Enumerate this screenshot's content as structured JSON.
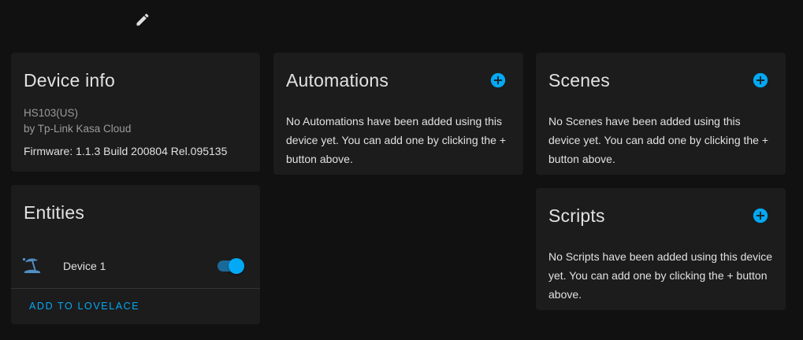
{
  "colors": {
    "background": "#111111",
    "card": "#1c1c1c",
    "accent": "#03a9f4",
    "text": "#e1e1e1",
    "muted": "#9b9b9b"
  },
  "header": {
    "edit_icon": "pencil-icon"
  },
  "device_info": {
    "title": "Device info",
    "model": "HS103(US)",
    "manufacturer": "by Tp-Link Kasa Cloud",
    "firmware": "Firmware: 1.1.3 Build 200804 Rel.095135"
  },
  "entities": {
    "title": "Entities",
    "items": [
      {
        "name": "Device 1",
        "icon": "beach-umbrella-icon",
        "state": "on"
      }
    ],
    "add_button_label": "ADD TO LOVELACE"
  },
  "automations": {
    "title": "Automations",
    "add_icon": "plus-circle-icon",
    "empty_text": "No Automations have been added using this device yet. You can add one by clicking the + button above."
  },
  "scenes": {
    "title": "Scenes",
    "add_icon": "plus-circle-icon",
    "empty_text": "No Scenes have been added using this device yet. You can add one by clicking the + button above."
  },
  "scripts": {
    "title": "Scripts",
    "add_icon": "plus-circle-icon",
    "empty_text": "No Scripts have been added using this device yet. You can add one by clicking the + button above."
  }
}
